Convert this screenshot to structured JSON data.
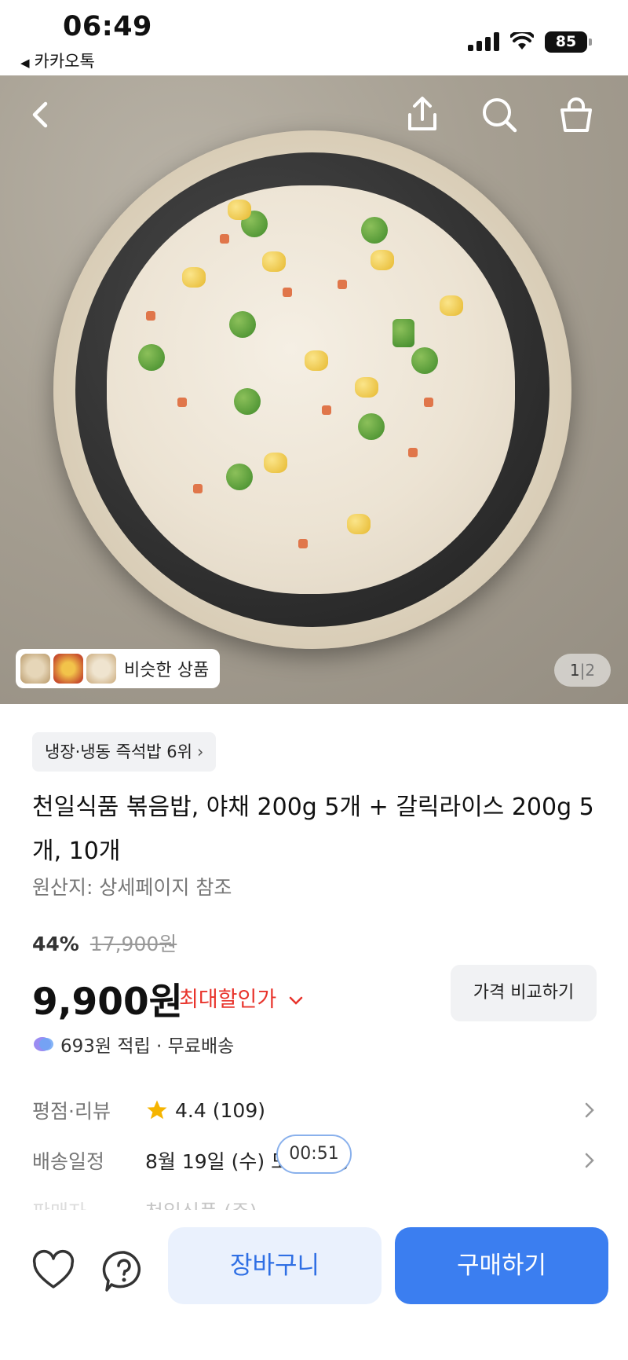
{
  "status_bar": {
    "time": "06:49",
    "back_app": "카카오톡",
    "battery": "85"
  },
  "gallery": {
    "similar_label": "비슷한 상품",
    "page_current": "1",
    "page_separator": "|",
    "page_total": "2"
  },
  "product": {
    "rank_badge": "냉장·냉동 즉석밥 6위",
    "title": "천일식품 볶음밥, 야채 200g 5개 + 갈릭라이스 200g 5개, 10개",
    "origin": "원산지: 상세페이지 참조",
    "discount_rate": "44%",
    "original_price": "17,900원",
    "price": "9,900원",
    "max_discount_label": "최대할인가",
    "compare_button": "가격 비교하기",
    "points": "693원 적립 · 무료배송"
  },
  "info_rows": {
    "rating_label": "평점·리뷰",
    "rating_value": "4.4",
    "rating_count": "(109)",
    "delivery_label": "배송일정",
    "delivery_value": "8월 19일 (수) 도착 예정",
    "seller_label": "판매자",
    "seller_value": "천일식품 (주)"
  },
  "timer": "00:51",
  "bottom": {
    "cart_button": "장바구니",
    "buy_button": "구매하기"
  },
  "colors": {
    "accent": "#3b7ef0",
    "discount": "#e8342c",
    "star": "#f5b400"
  }
}
